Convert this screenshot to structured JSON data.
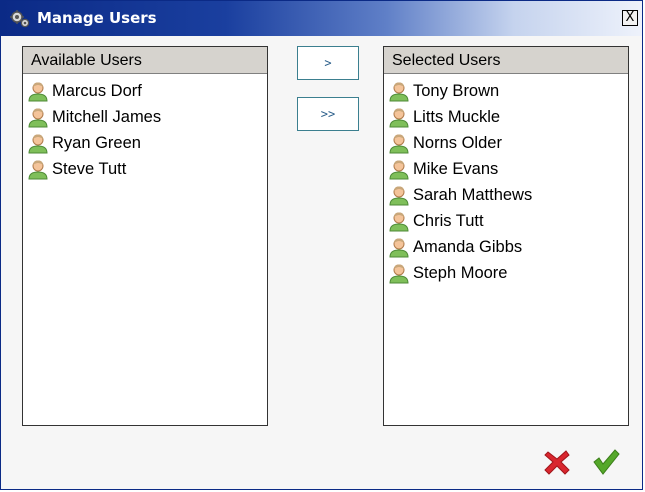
{
  "window": {
    "title": "Manage Users",
    "close_label": "X"
  },
  "available": {
    "header": "Available Users",
    "items": [
      "Marcus Dorf",
      "Mitchell James",
      "Ryan Green",
      "Steve Tutt"
    ]
  },
  "buttons": {
    "move_one": ">",
    "move_all": ">>"
  },
  "selected": {
    "header": "Selected Users",
    "items": [
      "Tony Brown",
      "Litts Muckle",
      "Norns Older",
      "Mike Evans",
      "Sarah Matthews",
      "Chris Tutt",
      "Amanda Gibbs",
      "Steph Moore"
    ]
  },
  "icons": {
    "title": "gears-icon",
    "user": "user-icon",
    "cancel": "red-x-icon",
    "confirm": "green-check-icon"
  },
  "colors": {
    "titlebar": "#0b2a86",
    "cancel": "#d9262e",
    "confirm": "#55a82a"
  }
}
